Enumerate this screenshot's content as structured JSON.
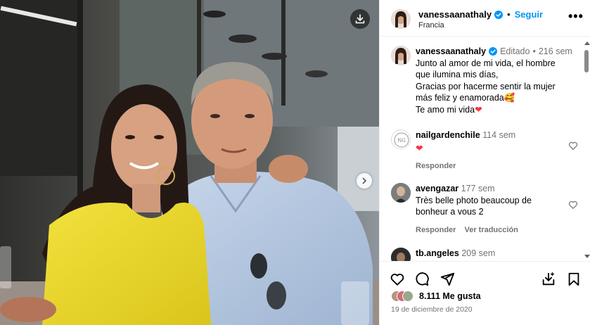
{
  "post": {
    "username": "vanessaanathaly",
    "follow_label": "Seguir",
    "location": "Francia",
    "more_label": "•••"
  },
  "caption": {
    "username": "vanessaanathaly",
    "edited": "Editado",
    "age": "216 sem",
    "lines": [
      "Junto al amor de mi vida, el hombre",
      "que ilumina mis días,",
      "Gracias por hacerme sentir la mujer",
      "más feliz y enamorada🥰",
      "Te amo mi vida"
    ]
  },
  "comments": [
    {
      "username": "nailgardenchile",
      "age": "114 sem",
      "text": "",
      "actions": [
        "Responder"
      ]
    },
    {
      "username": "avengazar",
      "age": "177 sem",
      "text": "Très belle photo beaucoup de bonheur a vous 2",
      "actions": [
        "Responder",
        "Ver traducción"
      ]
    },
    {
      "username": "tb.angeles",
      "age": "209 sem",
      "text": "",
      "actions": []
    }
  ],
  "footer": {
    "likes_count": "8.111",
    "likes_label": "Me gusta",
    "date": "19 de diciembre de 2020"
  },
  "icons": {
    "like": "heart-icon",
    "comment": "comment-icon",
    "share": "share-icon",
    "save": "bookmark-icon",
    "download": "download-icon",
    "verified": "verified-badge-icon"
  },
  "colors": {
    "accent": "#0095f6",
    "heart": "#ff3040",
    "muted": "#737373"
  }
}
